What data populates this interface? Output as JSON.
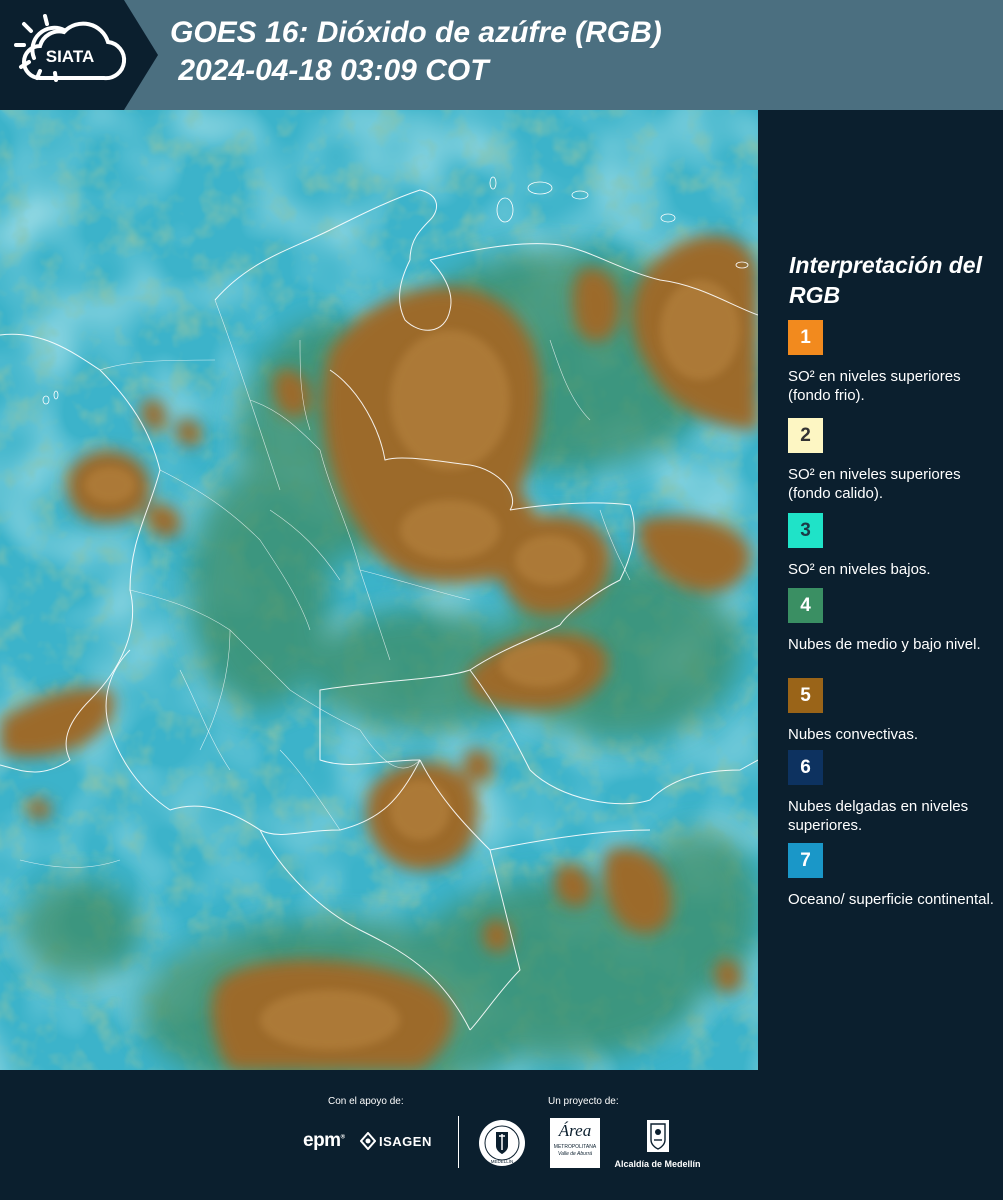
{
  "header": {
    "title_line1": "GOES 16: Dióxido de azúfre (RGB)",
    "title_line2": " 2024-04-18 03:09 COT",
    "logo_text": "SIATA",
    "logo_icon": "sun-cloud-icon"
  },
  "legend": {
    "title": "Interpretación del RGB",
    "items": [
      {
        "number": "1",
        "color": "#f28a1e",
        "number_color": "#ffffff",
        "description": "SO² en niveles superiores (fondo frio)."
      },
      {
        "number": "2",
        "color": "#fdf6c3",
        "number_color": "#333333",
        "description": "SO² en niveles superiores (fondo calido)."
      },
      {
        "number": "3",
        "color": "#1fe3c8",
        "number_color": "#1b3b47",
        "description": "SO² en niveles bajos."
      },
      {
        "number": "4",
        "color": "#3a8f63",
        "number_color": "#ffffff",
        "description": "Nubes de medio y bajo nivel."
      },
      {
        "number": "5",
        "color": "#9a6418",
        "number_color": "#ffffff",
        "description": "Nubes convectivas."
      },
      {
        "number": "6",
        "color": "#0d3260",
        "number_color": "#ffffff",
        "description": "Nubes delgadas en niveles superiores."
      },
      {
        "number": "7",
        "color": "#1a97c8",
        "number_color": "#ffffff",
        "description": "Oceano/ superficie continental."
      }
    ]
  },
  "footer": {
    "support_label": "Con el apoyo de:",
    "project_label": "Un proyecto de:",
    "epm_text": "epm",
    "isagen_text": "ISAGEN",
    "area_text": "Área",
    "area_sub1": "METROPOLITANA",
    "area_sub2": "Valle de Aburrá",
    "alcaldia_text": "Alcaldía de Medellín",
    "seal_text": "MEDELLÍN"
  },
  "map": {
    "colors": {
      "ocean_cyan": "#3fb6cc",
      "pale_cyan": "#7ad2dc",
      "green_low": "#3f8f6a",
      "convective": "#9a6a2a",
      "convective_light": "#b07a35",
      "border": "#ffffff"
    }
  }
}
